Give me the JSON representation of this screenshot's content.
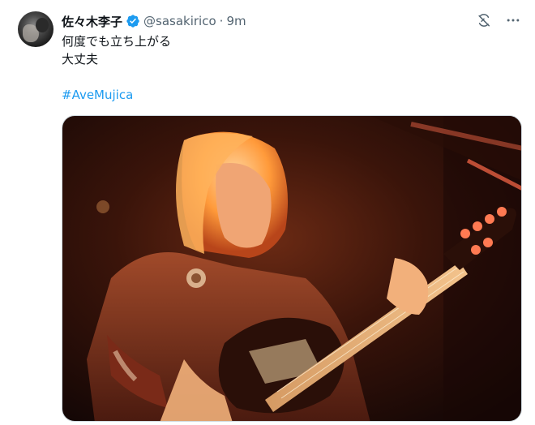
{
  "tweet": {
    "display_name": "佐々木李子",
    "handle": "@sasakirico",
    "separator": "·",
    "time": "9m",
    "lines": [
      "何度でも立ち上がる",
      "大丈夫"
    ],
    "hashtag": "#AveMujica",
    "brand_color": "#1d9bf0",
    "verified": true
  },
  "icons": {
    "verified": "verified-badge-icon",
    "grok": "grok-icon",
    "more": "more-icon"
  },
  "media": {
    "kind": "photo",
    "description_for_icon": "guitarist-photo"
  }
}
